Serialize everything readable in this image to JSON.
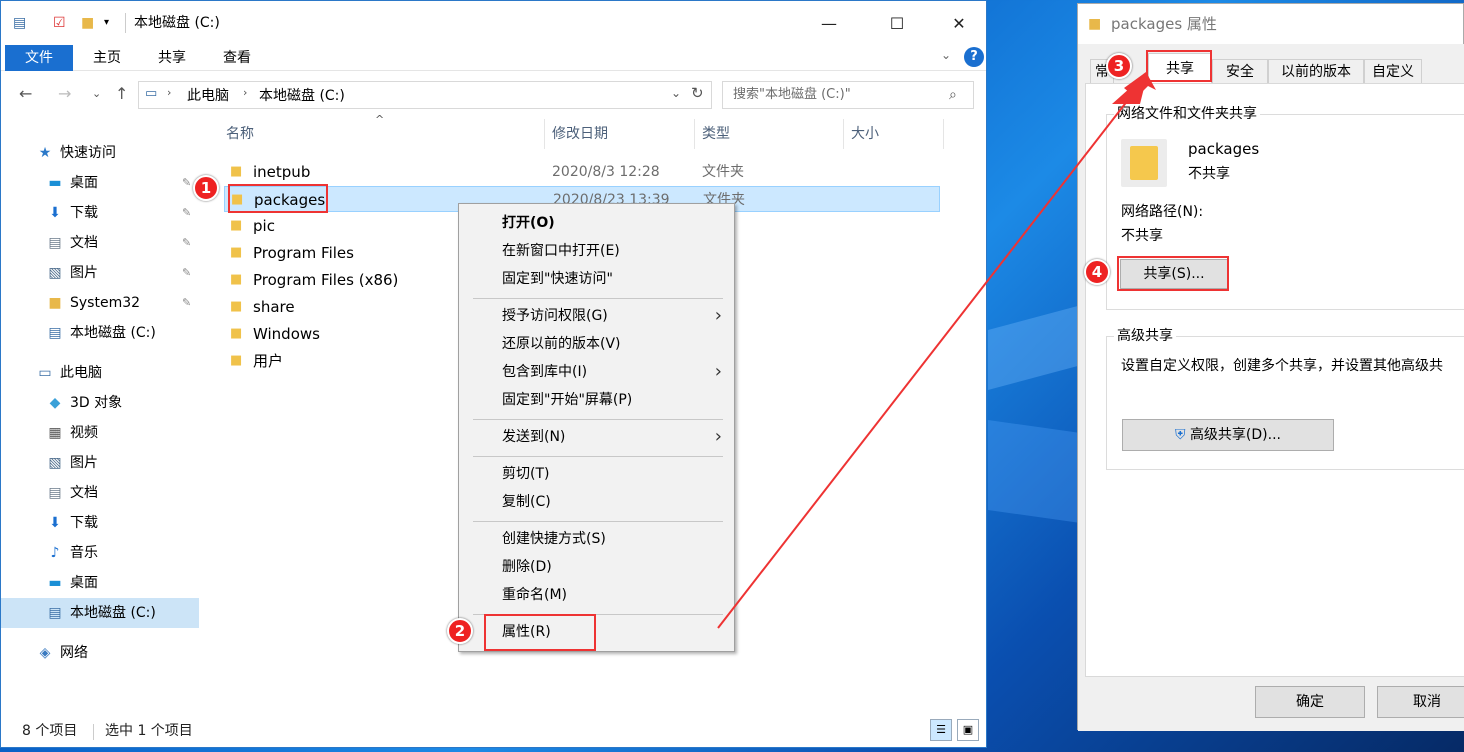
{
  "explorer": {
    "title": "本地磁盘 (C:)",
    "ribbon_tabs": [
      "文件",
      "主页",
      "共享",
      "查看"
    ],
    "address_path": [
      "此电脑",
      "本地磁盘 (C:)"
    ],
    "search_placeholder": "搜索\"本地磁盘 (C:)\"",
    "nav": [
      {
        "label": "快速访问",
        "icon": "star-icon",
        "pinned": false
      },
      {
        "label": "桌面",
        "icon": "desktop-icon",
        "pinned": true
      },
      {
        "label": "下载",
        "icon": "download-icon",
        "pinned": true
      },
      {
        "label": "文档",
        "icon": "document-icon",
        "pinned": true
      },
      {
        "label": "图片",
        "icon": "picture-icon",
        "pinned": true
      },
      {
        "label": "System32",
        "icon": "folder-icon",
        "pinned": true
      },
      {
        "label": "本地磁盘 (C:)",
        "icon": "drive-icon",
        "pinned": false
      },
      {
        "label": "此电脑",
        "icon": "computer-icon",
        "pinned": false
      },
      {
        "label": "3D 对象",
        "icon": "cube-icon",
        "pinned": false
      },
      {
        "label": "视频",
        "icon": "video-icon",
        "pinned": false
      },
      {
        "label": "图片",
        "icon": "picture-icon",
        "pinned": false
      },
      {
        "label": "文档",
        "icon": "document-icon",
        "pinned": false
      },
      {
        "label": "下载",
        "icon": "download-icon",
        "pinned": false
      },
      {
        "label": "音乐",
        "icon": "music-icon",
        "pinned": false
      },
      {
        "label": "桌面",
        "icon": "desktop-icon",
        "pinned": false
      },
      {
        "label": "本地磁盘 (C:)",
        "icon": "drive-icon",
        "pinned": false
      },
      {
        "label": "网络",
        "icon": "network-icon",
        "pinned": false
      }
    ],
    "columns": [
      "名称",
      "修改日期",
      "类型",
      "大小"
    ],
    "files": [
      {
        "name": "inetpub",
        "date": "2020/8/3 12:28",
        "type": "文件夹"
      },
      {
        "name": "packages",
        "date": "2020/8/23 13:39",
        "type": "文件夹"
      },
      {
        "name": "pic",
        "date": "",
        "type": "夹"
      },
      {
        "name": "Program Files",
        "date": "",
        "type": "夹"
      },
      {
        "name": "Program Files (x86)",
        "date": "",
        "type": "夹"
      },
      {
        "name": "share",
        "date": "",
        "type": "夹"
      },
      {
        "name": "Windows",
        "date": "",
        "type": "夹"
      },
      {
        "name": "用户",
        "date": "",
        "type": "夹"
      }
    ],
    "status_count": "8 个项目",
    "status_selected": "选中 1 个项目"
  },
  "context_menu": {
    "items": [
      {
        "label": "打开(O)",
        "bold": true,
        "arrow": false
      },
      {
        "label": "在新窗口中打开(E)",
        "bold": false,
        "arrow": false
      },
      {
        "label": "固定到\"快速访问\"",
        "bold": false,
        "arrow": false
      },
      {
        "label": "授予访问权限(G)",
        "bold": false,
        "arrow": true
      },
      {
        "label": "还原以前的版本(V)",
        "bold": false,
        "arrow": false
      },
      {
        "label": "包含到库中(I)",
        "bold": false,
        "arrow": true
      },
      {
        "label": "固定到\"开始\"屏幕(P)",
        "bold": false,
        "arrow": false
      },
      {
        "label": "发送到(N)",
        "bold": false,
        "arrow": true
      },
      {
        "label": "剪切(T)",
        "bold": false,
        "arrow": false
      },
      {
        "label": "复制(C)",
        "bold": false,
        "arrow": false
      },
      {
        "label": "创建快捷方式(S)",
        "bold": false,
        "arrow": false
      },
      {
        "label": "删除(D)",
        "bold": false,
        "arrow": false
      },
      {
        "label": "重命名(M)",
        "bold": false,
        "arrow": false
      },
      {
        "label": "属性(R)",
        "bold": false,
        "arrow": false
      }
    ]
  },
  "properties": {
    "title": "packages 属性",
    "tabs": [
      "常",
      "共享",
      "安全",
      "以前的版本",
      "自定义"
    ],
    "group1_label": "网络文件和文件夹共享",
    "folder_name": "packages",
    "share_state": "不共享",
    "network_path_label": "网络路径(N):",
    "network_path_value": "不共享",
    "share_button": "共享(S)...",
    "group2_label": "高级共享",
    "advanced_desc": "设置自定义权限，创建多个共享，并设置其他高级共",
    "advanced_button": "高级共享(D)...",
    "ok": "确定",
    "cancel": "取消"
  },
  "badges": [
    "1",
    "2",
    "3",
    "4"
  ],
  "colors": {
    "highlight_red": "#ee3333",
    "selection": "#cce8ff",
    "ribbon_file": "#1a6fd0"
  }
}
